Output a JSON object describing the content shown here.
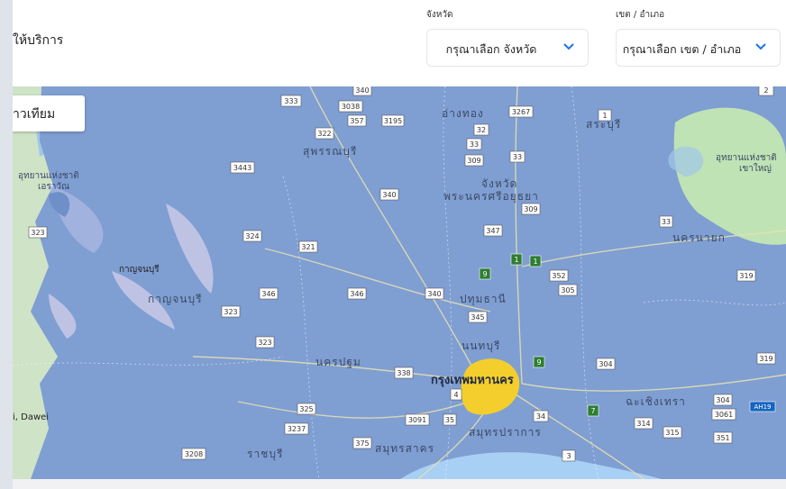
{
  "header": {
    "title": "ให้บริการ",
    "province": {
      "label": "จังหวัด",
      "placeholder": "กรุณาเลือก จังหวัด"
    },
    "district": {
      "label": "เขต / อำเภอ",
      "placeholder": "กรุณาเลือก เขต / อำเภอ"
    }
  },
  "map": {
    "toggle_label": "าวเทียม",
    "labels": {
      "suphanburi": "สุพรรณบุรี",
      "angthong": "อ่างทอง",
      "saraburi": "สระบุรี",
      "ayutthaya_1": "จังหวัด",
      "ayutthaya_2": "พระนครศรีอยุธยา",
      "nakhonnayok": "นครนายก",
      "khaoyai_1": "อุทยานแห่งชาติ",
      "khaoyai_2": "เขาใหญ่",
      "erawan_1": "อุทยานแห่งชาติ",
      "erawan_2": "เอราวัณ",
      "kanchanaburi_town": "กาญจนบุรี",
      "kanchanaburi": "กาญจนบุรี",
      "pathumthani": "ปทุมธานี",
      "nonthaburi": "นนทบุรี",
      "nakhonpathom": "นครปฐม",
      "bangkok": "กรุงเทพมหานคร",
      "chachoengsao": "ฉะเชิงเทรา",
      "samutprakan": "สมุทรปราการ",
      "samutsakhon": "สมุทรสาคร",
      "ratchaburi": "ราชบุรี",
      "dawei": "i, Dawei"
    },
    "road_shields": [
      "340",
      "333",
      "3038",
      "357",
      "3195",
      "322",
      "3267",
      "32",
      "1",
      "33",
      "309",
      "33",
      "3443",
      "340",
      "309",
      "347",
      "324",
      "321",
      "1",
      "1",
      "9",
      "352",
      "305",
      "346",
      "346",
      "340",
      "345",
      "323",
      "323",
      "9",
      "304",
      "319",
      "338",
      "4",
      "35",
      "3091",
      "325",
      "3237",
      "375",
      "3208",
      "34",
      "7",
      "304",
      "3061",
      "314",
      "315",
      "351",
      "AH19",
      "3",
      "2",
      "319",
      "33",
      "323"
    ],
    "colors": {
      "overlay": "#7f9ed2",
      "highlight": "#f4ce2c",
      "sea": "#a8cff4"
    }
  }
}
